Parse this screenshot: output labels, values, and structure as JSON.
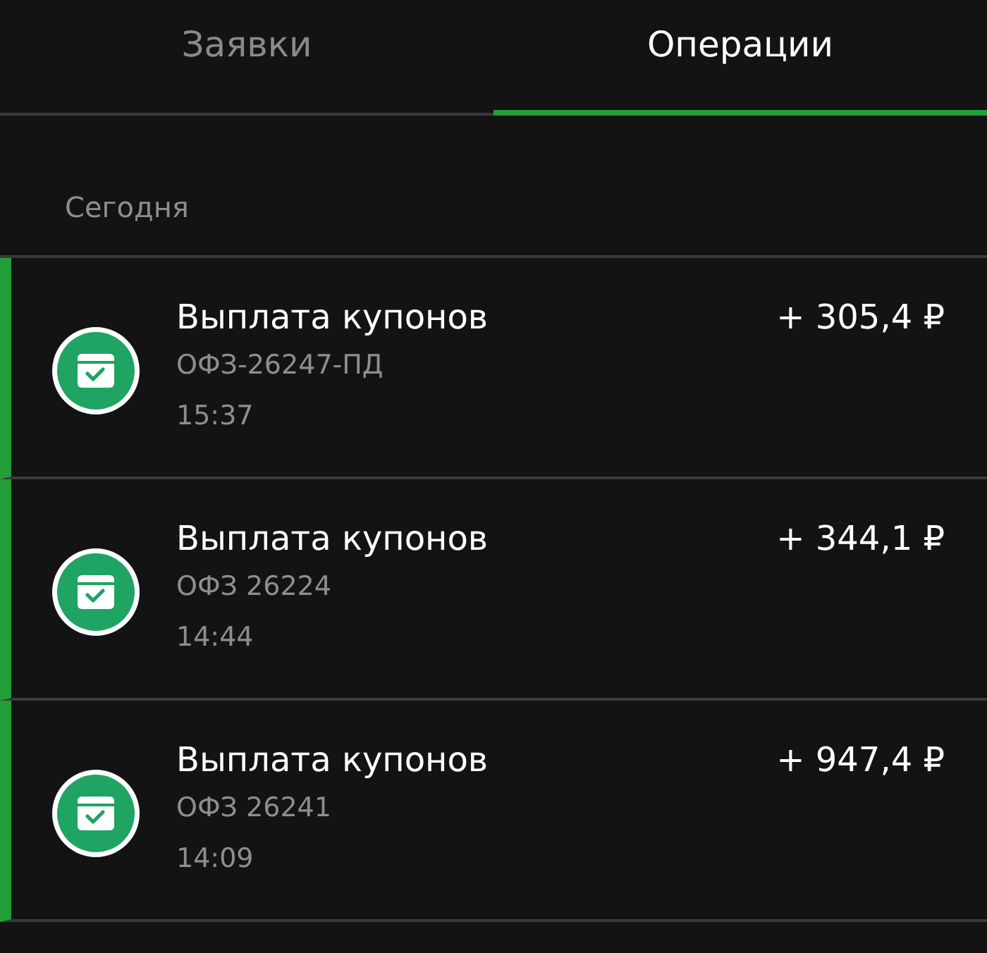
{
  "tabs": [
    {
      "label": "Заявки",
      "selected": false
    },
    {
      "label": "Операции",
      "selected": true
    }
  ],
  "section": "Сегодня",
  "operations": [
    {
      "title": "Выплата купонов",
      "security": "ОФЗ-26247-ПД",
      "time": "15:37",
      "amount": "+ 305,4 ₽"
    },
    {
      "title": "Выплата купонов",
      "security": "ОФЗ 26224",
      "time": "14:44",
      "amount": "+ 344,1 ₽"
    },
    {
      "title": "Выплата купонов",
      "security": "ОФЗ 26241",
      "time": "14:09",
      "amount": "+ 947,4 ₽"
    }
  ]
}
